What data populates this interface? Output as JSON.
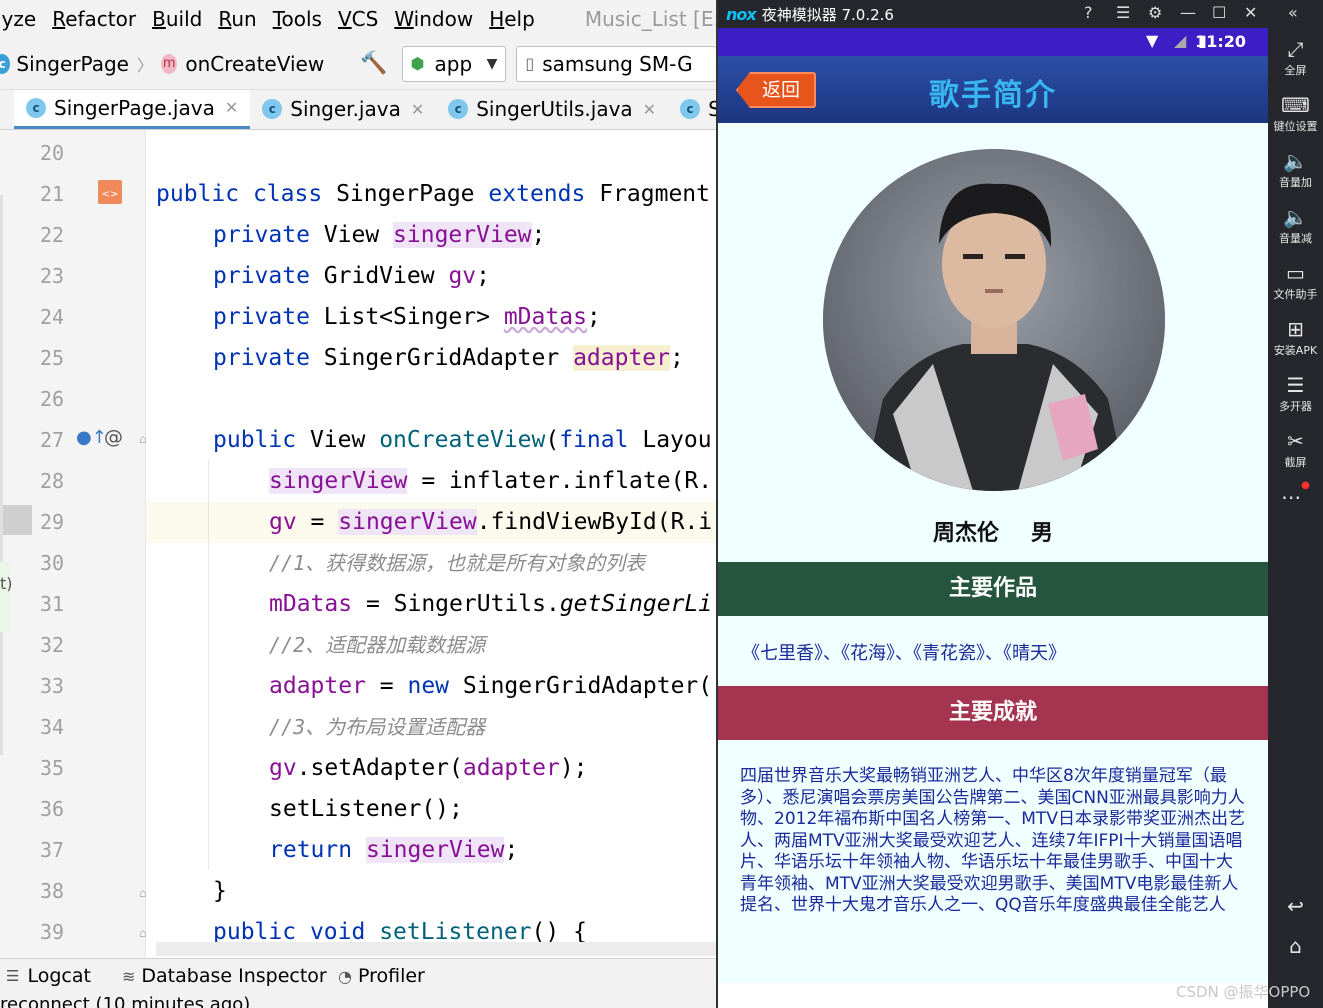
{
  "ide": {
    "menu": [
      "lyze",
      "Refactor",
      "Build",
      "Run",
      "Tools",
      "VCS",
      "Window",
      "Help"
    ],
    "project_title": "Music_List [E:",
    "breadcrumb": {
      "file": "SingerPage",
      "method": "onCreateView"
    },
    "run_config": "app",
    "device": "samsung SM-G",
    "tabs": [
      "SingerPage.java",
      "Singer.java",
      "SingerUtils.java",
      "S"
    ],
    "line_numbers": [
      "20",
      "21",
      "22",
      "23",
      "24",
      "25",
      "26",
      "27",
      "28",
      "29",
      "30",
      "31",
      "32",
      "33",
      "34",
      "35",
      "36",
      "37",
      "38",
      "39"
    ],
    "bottom_tools": [
      "Logcat",
      "Database Inspector",
      "Profiler"
    ],
    "status_text": "reconnect (10 minutes ago)"
  },
  "code": {
    "l21": [
      "public",
      "class",
      "SingerPage",
      "extends",
      "Fragment"
    ],
    "l22": [
      "private",
      "View",
      "singerView",
      ";"
    ],
    "l23": [
      "private",
      "GridView",
      "gv",
      ";"
    ],
    "l24": [
      "private",
      "List<Singer>",
      "mDatas",
      ";"
    ],
    "l25": [
      "private",
      "SingerGridAdapter",
      "adapter",
      ";"
    ],
    "l27": [
      "public",
      "View",
      "onCreateView",
      "(",
      "final",
      "Layou"
    ],
    "l28": [
      "singerView",
      " = inflater.inflate(R."
    ],
    "l29": [
      "gv",
      " = ",
      "singerView",
      ".findViewById(R.i"
    ],
    "l30": "//1、获得数据源，也就是所有对象的列表",
    "l31": [
      "mDatas",
      " = SingerUtils.",
      "getSingerLi"
    ],
    "l32": "//2、适配器加载数据源",
    "l33": [
      "adapter",
      " = ",
      "new",
      " SingerGridAdapter("
    ],
    "l34": "//3、为布局设置适配器",
    "l35": [
      "gv",
      ".setAdapter(",
      "adapter",
      ");"
    ],
    "l36": "setListener();",
    "l37": [
      "return",
      " ",
      "singerView",
      ";"
    ],
    "l38": "}",
    "l39": [
      "public",
      "void",
      "setListener",
      "() {"
    ]
  },
  "emulator": {
    "title": "夜神模拟器 7.0.2.6",
    "logo": "nox",
    "time": "11:20",
    "back_label": "返回",
    "app_title": "歌手简介",
    "singer_name": "周杰伦",
    "gender": "男",
    "works_title": "主要作品",
    "works": "《七里香》、《花海》、《青花瓷》、《晴天》",
    "achievements_title": "主要成就",
    "achievements": "四届世界音乐大奖最畅销亚洲艺人、中华区8次年度销量冠军（最多）、悉尼演唱会票房美国公告牌第二、美国CNN亚洲最具影响力人物、2012年福布斯中国名人榜第一、MTV日本录影带奖亚洲杰出艺人、两届MTV亚洲大奖最受欢迎艺人、连续7年IFPI十大销量国语唱片、华语乐坛十年领袖人物、华语乐坛十年最佳男歌手、中国十大青年领袖、MTV亚洲大奖最受欢迎男歌手、美国MTV电影最佳新人提名、世界十大鬼才音乐人之一、QQ音乐年度盛典最佳全能艺人",
    "side_tools": [
      "全屏",
      "键位设置",
      "音量加",
      "音量减",
      "文件助手",
      "安装APK",
      "多开器",
      "截屏"
    ]
  },
  "watermark": "CSDN @振华OPPO"
}
